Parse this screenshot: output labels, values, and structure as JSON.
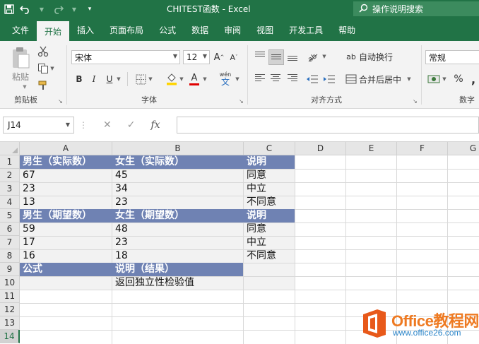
{
  "window": {
    "title": "CHITEST函数  -  Excel",
    "tell_me": "操作说明搜索",
    "qat": {
      "save_icon": "save-icon",
      "undo_icon": "undo-icon",
      "redo_icon": "redo-icon",
      "customize_icon": "customize-qat-icon"
    }
  },
  "tabs": [
    "文件",
    "开始",
    "插入",
    "页面布局",
    "公式",
    "数据",
    "审阅",
    "视图",
    "开发工具",
    "帮助"
  ],
  "active_tab": "开始",
  "ribbon": {
    "clipboard": {
      "paste_label": "粘贴",
      "group_label": "剪贴板"
    },
    "font": {
      "font_name": "宋体",
      "font_size": "12",
      "bold": "B",
      "italic": "I",
      "underline": "U",
      "phonetic": "wén",
      "group_label": "字体"
    },
    "alignment": {
      "wrap_text": "自动换行",
      "merge_center": "合并后居中",
      "group_label": "对齐方式"
    },
    "number": {
      "format": "常规",
      "percent": "%",
      "group_label": "数字"
    }
  },
  "formula_bar": {
    "name_box": "J14",
    "fx": "fx",
    "formula": ""
  },
  "grid": {
    "columns": [
      "A",
      "B",
      "C",
      "D",
      "E",
      "F",
      "G"
    ],
    "rows": [
      "1",
      "2",
      "3",
      "4",
      "5",
      "6",
      "7",
      "8",
      "9",
      "10",
      "11",
      "12",
      "13",
      "14"
    ],
    "selected_row": "14",
    "header_fill": "#6f82b3",
    "cells": {
      "A1": "男生（实际数）",
      "B1": "女生（实际数）",
      "C1": "说明",
      "A2": "67",
      "B2": "45",
      "C2": "同意",
      "A3": "23",
      "B3": "34",
      "C3": "中立",
      "A4": "13",
      "B4": "23",
      "C4": "不同意",
      "A5": "男生（期望数）",
      "B5": "女生（期望数）",
      "C5": "说明",
      "A6": "59",
      "B6": "48",
      "C6": "同意",
      "A7": "17",
      "B7": "23",
      "C7": "中立",
      "A8": "16",
      "B8": "18",
      "C8": "不同意",
      "A9": "公式",
      "B9": "说明（结果）",
      "B10": "返回独立性检验值"
    }
  },
  "watermark": {
    "line1": "Office教程网",
    "line2": "www.office26.com"
  }
}
